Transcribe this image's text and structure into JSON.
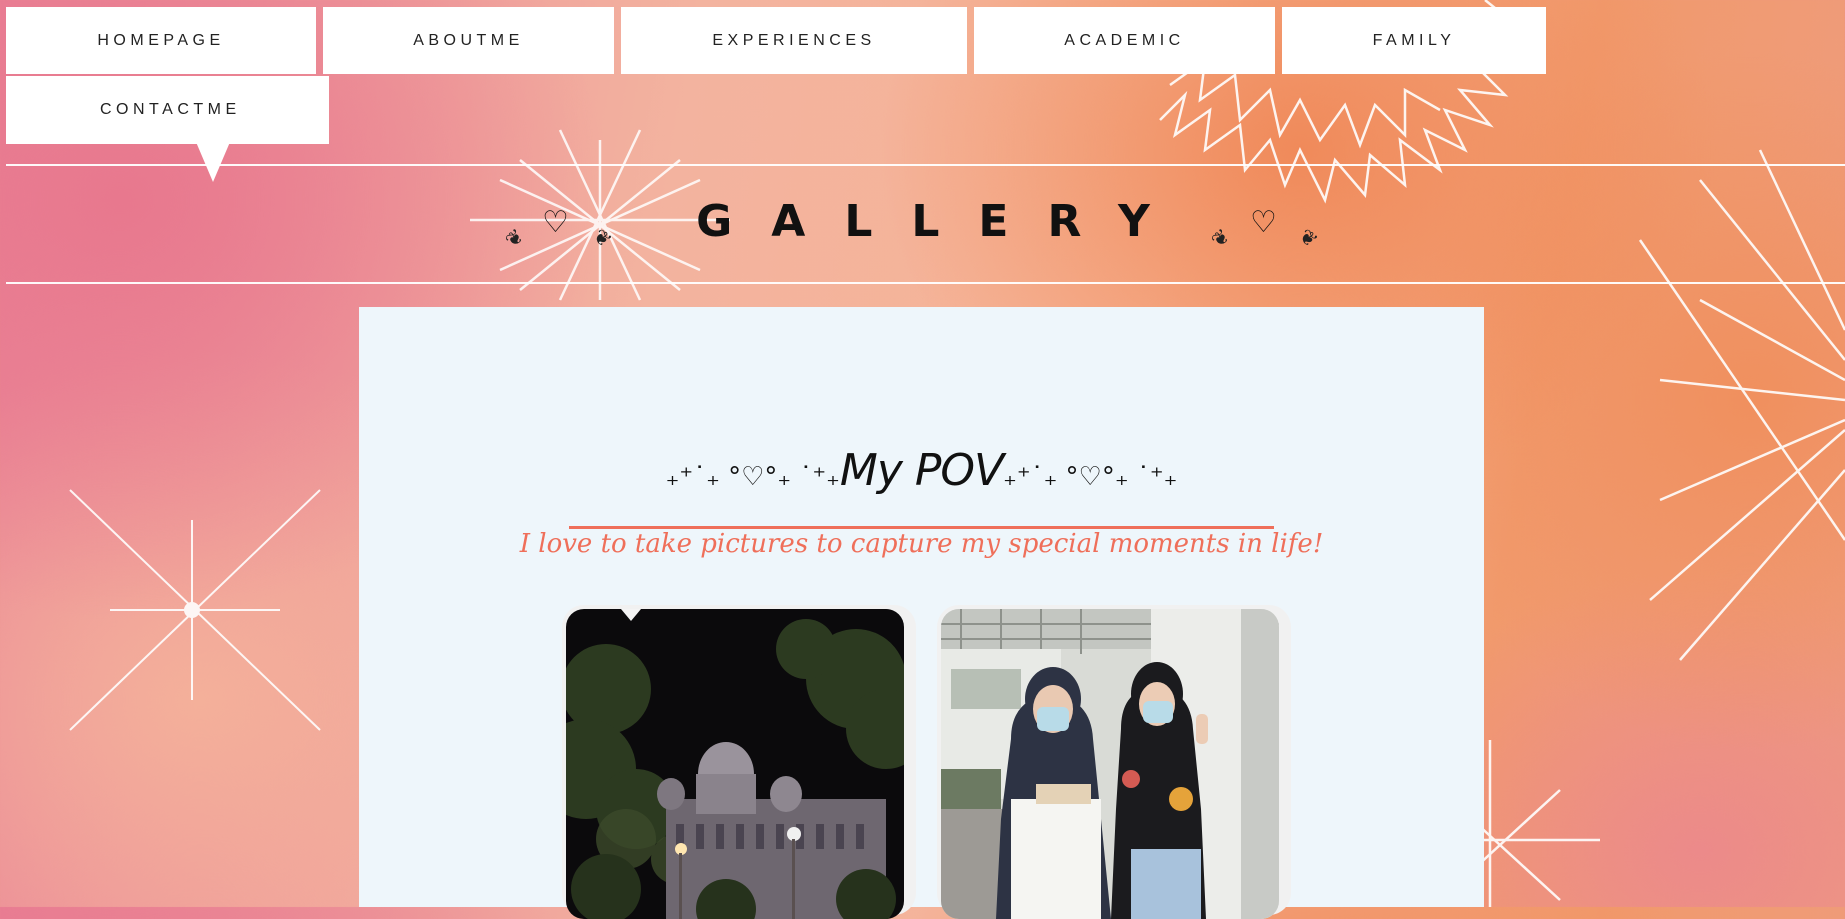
{
  "nav": {
    "items": [
      {
        "label": "HOMEPAGE"
      },
      {
        "label": "ABOUTME"
      },
      {
        "label": "EXPERIENCES"
      },
      {
        "label": "ACADEMIC"
      },
      {
        "label": "FAMILY"
      },
      {
        "label": "CONTACTME"
      }
    ]
  },
  "header": {
    "title": "GALLERY",
    "heart_left": "♡",
    "heart_right": "♡"
  },
  "main": {
    "heading_prefix": "₊⁺˙₊ °♡°₊ ˙⁺₊",
    "heading": "My POV",
    "heading_suffix": "₊⁺˙₊ °♡°₊ ˙⁺₊",
    "subtitle": "I love to take pictures to capture my special moments in life!"
  },
  "colors": {
    "accent": "#ef6f5a",
    "panel": "#eef6fb",
    "text": "#111111"
  }
}
